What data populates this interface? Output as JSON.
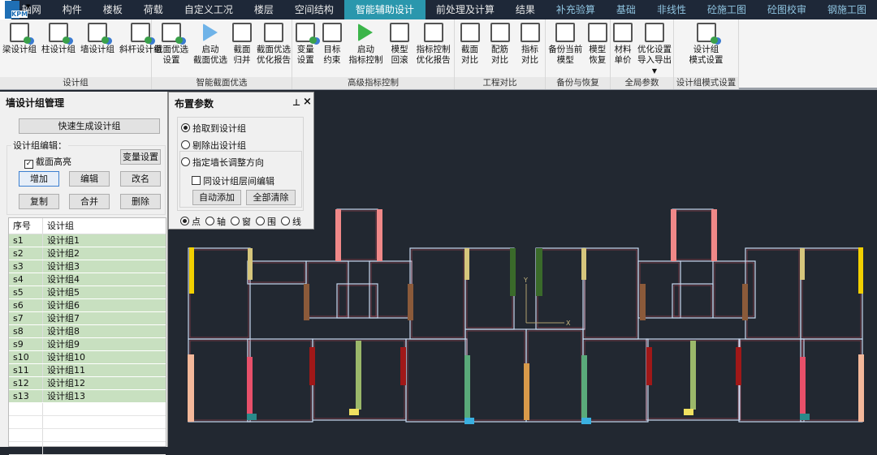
{
  "logo": {
    "text": "KPM"
  },
  "tabs": [
    {
      "label": "轴网"
    },
    {
      "label": "构件"
    },
    {
      "label": "楼板"
    },
    {
      "label": "荷载"
    },
    {
      "label": "自定义工况"
    },
    {
      "label": "楼层"
    },
    {
      "label": "空间结构"
    },
    {
      "label": "智能辅助设计",
      "active": true
    },
    {
      "label": "前处理及计算"
    },
    {
      "label": "结果"
    },
    {
      "label": "补充验算"
    },
    {
      "label": "基础"
    },
    {
      "label": "非线性"
    },
    {
      "label": "砼施工图"
    },
    {
      "label": "砼图校审"
    },
    {
      "label": "钢施工图"
    }
  ],
  "ribbon": {
    "groups": [
      {
        "label": "设计组",
        "buttons": [
          [
            "梁设计组",
            ""
          ],
          [
            "柱设计组",
            ""
          ],
          [
            "墙设计组",
            ""
          ],
          [
            "斜杆设计组",
            ""
          ]
        ]
      },
      {
        "label": "智能截面优选",
        "buttons": [
          [
            "截面优选",
            "设置"
          ],
          [
            "启动",
            "截面优选"
          ],
          [
            "截面",
            "归并"
          ],
          [
            "截面优选",
            "优化报告"
          ]
        ]
      },
      {
        "label": "高级指标控制",
        "buttons": [
          [
            "变量",
            "设置"
          ],
          [
            "目标",
            "约束"
          ],
          [
            "启动",
            "指标控制"
          ],
          [
            "模型",
            "回滚"
          ],
          [
            "指标控制",
            "优化报告"
          ]
        ]
      },
      {
        "label": "工程对比",
        "buttons": [
          [
            "截面",
            "对比"
          ],
          [
            "配筋",
            "对比"
          ],
          [
            "指标",
            "对比"
          ]
        ]
      },
      {
        "label": "备份与恢复",
        "buttons": [
          [
            "备份当前",
            "模型"
          ],
          [
            "模型",
            "恢复"
          ]
        ]
      },
      {
        "label": "全局参数",
        "buttons": [
          [
            "材料",
            "单价"
          ],
          [
            "优化设置",
            "导入导出"
          ]
        ]
      },
      {
        "label": "设计组模式设置",
        "buttons": [
          [
            "设计组",
            "模式设置"
          ]
        ]
      }
    ]
  },
  "left_panel": {
    "title": "墙设计组管理",
    "quick_generate": "快速生成设计组",
    "edit_group_label": "设计组编辑：",
    "highlight_checkbox": "截面高亮",
    "variable_settings": "变量设置",
    "add": "增加",
    "edit": "编辑",
    "rename": "改名",
    "copy": "复制",
    "merge": "合并",
    "delete": "删除",
    "table": {
      "headers": [
        "序号",
        "设计组"
      ],
      "rows": [
        [
          "s1",
          "设计组1"
        ],
        [
          "s2",
          "设计组2"
        ],
        [
          "s3",
          "设计组3"
        ],
        [
          "s4",
          "设计组4"
        ],
        [
          "s5",
          "设计组5"
        ],
        [
          "s6",
          "设计组6"
        ],
        [
          "s7",
          "设计组7"
        ],
        [
          "s8",
          "设计组8"
        ],
        [
          "s9",
          "设计组9"
        ],
        [
          "s10",
          "设计组10"
        ],
        [
          "s11",
          "设计组11"
        ],
        [
          "s12",
          "设计组12"
        ],
        [
          "s13",
          "设计组13"
        ]
      ]
    }
  },
  "param_panel": {
    "title": "布置参数",
    "pin": "ᵖ",
    "close": "×",
    "radio_pick": "拾取到设计组",
    "radio_remove": "剔除出设计组",
    "radio_direction": "指定墙长调整方向",
    "checkbox_interfloor": "同设计组层间编辑",
    "auto_add": "自动添加",
    "clear_all": "全部清除",
    "modes": [
      "点",
      "轴",
      "窗",
      "围",
      "线"
    ]
  },
  "canvas": {
    "axis_x": "X",
    "axis_y": "Y"
  }
}
